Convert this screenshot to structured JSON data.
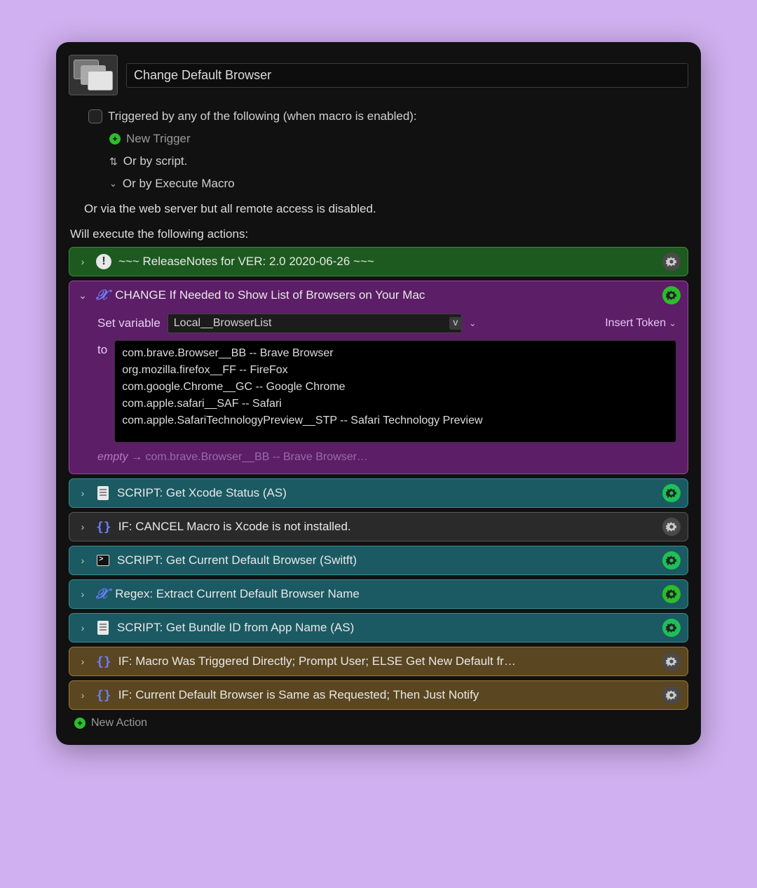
{
  "macro": {
    "title": "Change Default Browser"
  },
  "triggers": {
    "heading": "Triggered by any of the following (when macro is enabled):",
    "new_trigger": "New Trigger",
    "or_script": "Or by script.",
    "or_execute": "Or by Execute Macro",
    "remote": "Or via the web server but all remote access is disabled."
  },
  "will_execute": "Will execute the following actions:",
  "actions": [
    {
      "id": "release-notes",
      "color": "c-green",
      "icon": "bang",
      "title": "~~~ ReleaseNotes for  VER: 2.0    2020-06-26 ~~~",
      "gear": "gray",
      "expanded": false
    },
    {
      "id": "change-var",
      "color": "c-purple",
      "icon": "var-x",
      "title": "CHANGE If Needed to Show List of Browsers on Your Mac",
      "gear": "green",
      "expanded": true,
      "body": {
        "set_variable_label": "Set variable",
        "variable_name": "Local__BrowserList",
        "insert_token": "Insert Token",
        "to_label": "to",
        "to_value": "com.brave.Browser__BB -- Brave Browser\norg.mozilla.firefox__FF -- FireFox\ncom.google.Chrome__GC -- Google Chrome\ncom.apple.safari__SAF -- Safari\ncom.apple.SafariTechnologyPreview__STP -- Safari Technology Preview",
        "empty_label": "empty",
        "empty_preview": "com.brave.Browser__BB -- Brave Browser…"
      }
    },
    {
      "id": "script-xcode",
      "color": "c-teal",
      "icon": "doc",
      "title": "SCRIPT:  Get Xcode Status (AS)",
      "gear": "lime",
      "expanded": false
    },
    {
      "id": "if-cancel",
      "color": "c-dark",
      "icon": "braces",
      "title": "IF:  CANCEL Macro is Xcode is not installed.",
      "gear": "gray",
      "expanded": false
    },
    {
      "id": "script-current-default",
      "color": "c-teal",
      "icon": "term",
      "title": "SCRIPT: Get Current Default Browser (Switft)",
      "gear": "lime",
      "expanded": false
    },
    {
      "id": "regex-extract",
      "color": "c-teal",
      "icon": "var-x",
      "title": "Regex:  Extract Current Default Browser Name",
      "gear": "green",
      "expanded": false
    },
    {
      "id": "script-bundle-id",
      "color": "c-teal",
      "icon": "doc",
      "title": "SCRIPT:  Get Bundle ID from App Name (AS)",
      "gear": "lime",
      "expanded": false
    },
    {
      "id": "if-triggered",
      "color": "c-brown",
      "icon": "braces",
      "title": "IF:  Macro Was Triggered Directly; Prompt User; ELSE Get New Default fr…",
      "gear": "gray",
      "expanded": false
    },
    {
      "id": "if-same",
      "color": "c-brown",
      "icon": "braces",
      "title": "IF:  Current Default Browser is Same as Requested;  Then Just Notify",
      "gear": "gray",
      "expanded": false
    }
  ],
  "new_action": "New Action"
}
